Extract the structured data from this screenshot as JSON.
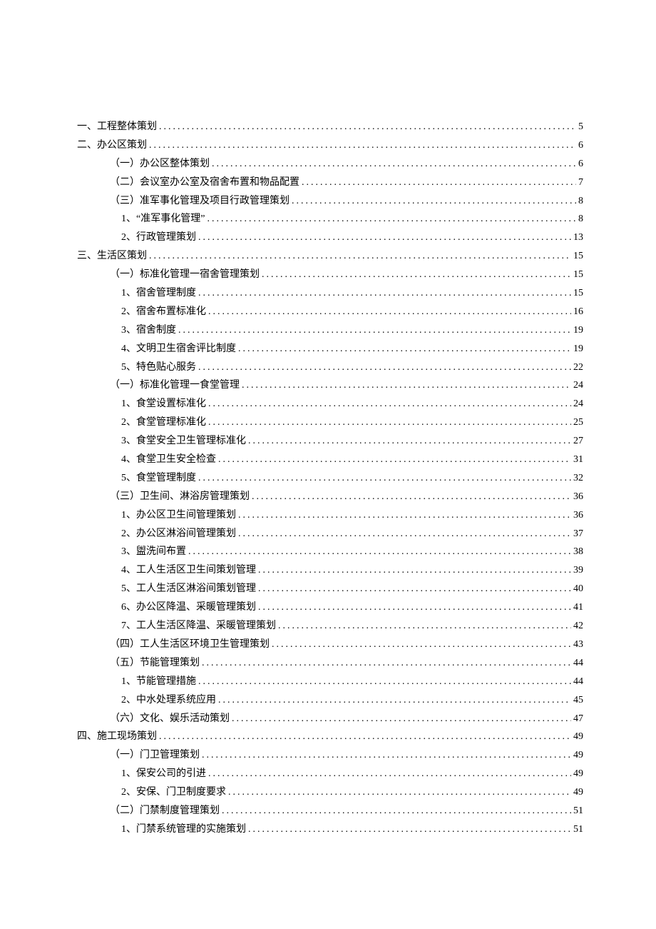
{
  "toc": [
    {
      "level": 0,
      "label": "一、工程整体策划",
      "page": "5"
    },
    {
      "level": 0,
      "label": "二、办公区策划",
      "page": "6"
    },
    {
      "level": 1,
      "label": "（一）办公区整体策划",
      "page": "6"
    },
    {
      "level": 1,
      "label": "（二）会议室办公室及宿舍布置和物品配置",
      "page": "7"
    },
    {
      "level": 1,
      "label": "（三）准军事化管理及项目行政管理策划",
      "page": "8"
    },
    {
      "level": 2,
      "label": "1、“准军事化管理”",
      "page": "8"
    },
    {
      "level": 2,
      "label": "2、行政管理策划",
      "page": "13"
    },
    {
      "level": 0,
      "label": "三、生活区策划",
      "page": "15"
    },
    {
      "level": 1,
      "label": "（一）标准化管理一宿舍管理策划",
      "page": "15"
    },
    {
      "level": 2,
      "label": "1、宿舍管理制度",
      "page": "15"
    },
    {
      "level": 2,
      "label": "2、宿舍布置标准化",
      "page": "16"
    },
    {
      "level": 2,
      "label": "3、宿舍制度",
      "page": "19"
    },
    {
      "level": 2,
      "label": "4、文明卫生宿舍评比制度",
      "page": "19"
    },
    {
      "level": 2,
      "label": "5、特色贴心服务",
      "page": "22"
    },
    {
      "level": 1,
      "label": "（一）标准化管理一食堂管理",
      "page": "24"
    },
    {
      "level": 2,
      "label": "1、食堂设置标准化",
      "page": "24"
    },
    {
      "level": 2,
      "label": "2、食堂管理标准化",
      "page": "25"
    },
    {
      "level": 2,
      "label": "3、食堂安全卫生管理标准化",
      "page": "27"
    },
    {
      "level": 2,
      "label": "4、食堂卫生安全检查",
      "page": "31"
    },
    {
      "level": 2,
      "label": "5、食堂管理制度",
      "page": "32"
    },
    {
      "level": 1,
      "label": "（三）卫生间、淋浴房管理策划",
      "page": "36"
    },
    {
      "level": 2,
      "label": "1、办公区卫生间管理策划",
      "page": "36"
    },
    {
      "level": 2,
      "label": "2、办公区淋浴间管理策划",
      "page": "37"
    },
    {
      "level": 2,
      "label": "3、盥洗间布置",
      "page": "38"
    },
    {
      "level": 2,
      "label": "4、工人生活区卫生间策划管理",
      "page": "39"
    },
    {
      "level": 2,
      "label": "5、工人生活区淋浴间策划管理",
      "page": "40"
    },
    {
      "level": 2,
      "label": "6、办公区降温、采暖管理策划",
      "page": "41"
    },
    {
      "level": 2,
      "label": "7、工人生活区降温、采暖管理策划",
      "page": "42"
    },
    {
      "level": 1,
      "label": "（四）工人生活区环境卫生管理策划",
      "page": "43"
    },
    {
      "level": 1,
      "label": "（五）节能管理策划",
      "page": "44"
    },
    {
      "level": 2,
      "label": "1、节能管理措施",
      "page": "44"
    },
    {
      "level": 2,
      "label": "2、中水处理系统应用",
      "page": "45"
    },
    {
      "level": 1,
      "label": "（六）文化、娱乐活动策划",
      "page": "47"
    },
    {
      "level": 0,
      "label": "四、施工现场策划",
      "page": "49"
    },
    {
      "level": 1,
      "label": "（一）门卫管理策划",
      "page": "49"
    },
    {
      "level": 2,
      "label": "1、保安公司的引进",
      "page": "49"
    },
    {
      "level": 2,
      "label": "2、安保、门卫制度要求",
      "page": "49"
    },
    {
      "level": 1,
      "label": "（二）门禁制度管理策划",
      "page": "51"
    },
    {
      "level": 2,
      "label": "1、门禁系统管理的实施策划",
      "page": "51"
    }
  ]
}
